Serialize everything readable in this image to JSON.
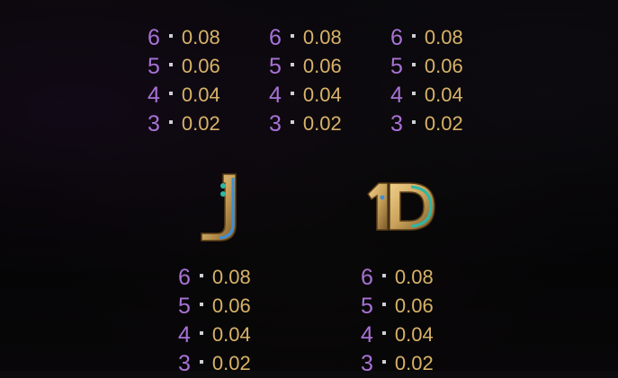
{
  "paytables": [
    {
      "rows": [
        {
          "count": "6",
          "payout": "0.08"
        },
        {
          "count": "5",
          "payout": "0.06"
        },
        {
          "count": "4",
          "payout": "0.04"
        },
        {
          "count": "3",
          "payout": "0.02"
        }
      ]
    },
    {
      "rows": [
        {
          "count": "6",
          "payout": "0.08"
        },
        {
          "count": "5",
          "payout": "0.06"
        },
        {
          "count": "4",
          "payout": "0.04"
        },
        {
          "count": "3",
          "payout": "0.02"
        }
      ]
    },
    {
      "rows": [
        {
          "count": "6",
          "payout": "0.08"
        },
        {
          "count": "5",
          "payout": "0.06"
        },
        {
          "count": "4",
          "payout": "0.04"
        },
        {
          "count": "3",
          "payout": "0.02"
        }
      ]
    },
    {
      "symbol": "j-symbol-icon",
      "rows": [
        {
          "count": "6",
          "payout": "0.08"
        },
        {
          "count": "5",
          "payout": "0.06"
        },
        {
          "count": "4",
          "payout": "0.04"
        },
        {
          "count": "3",
          "payout": "0.02"
        }
      ]
    },
    {
      "symbol": "ten-symbol-icon",
      "rows": [
        {
          "count": "6",
          "payout": "0.08"
        },
        {
          "count": "5",
          "payout": "0.06"
        },
        {
          "count": "4",
          "payout": "0.04"
        },
        {
          "count": "3",
          "payout": "0.02"
        }
      ]
    }
  ],
  "colors": {
    "count": "#a872d6",
    "payout": "#d8b268",
    "symbol_gold": "#c9a15a",
    "symbol_teal": "#2fb7a6",
    "symbol_blue": "#3d8fd6"
  }
}
